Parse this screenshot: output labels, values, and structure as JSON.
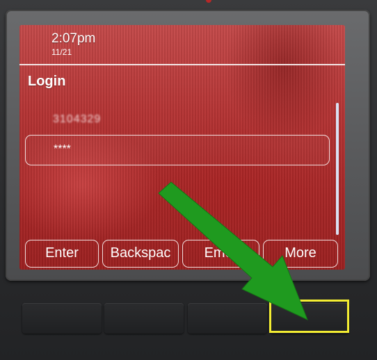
{
  "status": {
    "time": "2:07pm",
    "date": "11/21"
  },
  "screen": {
    "title": "Login",
    "user_id": "3104329",
    "pin_masked": "****"
  },
  "softkeys": [
    {
      "label": "Enter"
    },
    {
      "label": "Backspac"
    },
    {
      "label": "Emer"
    },
    {
      "label": "More"
    }
  ],
  "colors": {
    "screen_background": "#b63535",
    "annotation_arrow": "#1f9a1f",
    "highlight_box": "#f3ed32"
  },
  "annotation": {
    "arrow_icon": "green-arrow-icon",
    "target": "fourth-hard-key"
  }
}
